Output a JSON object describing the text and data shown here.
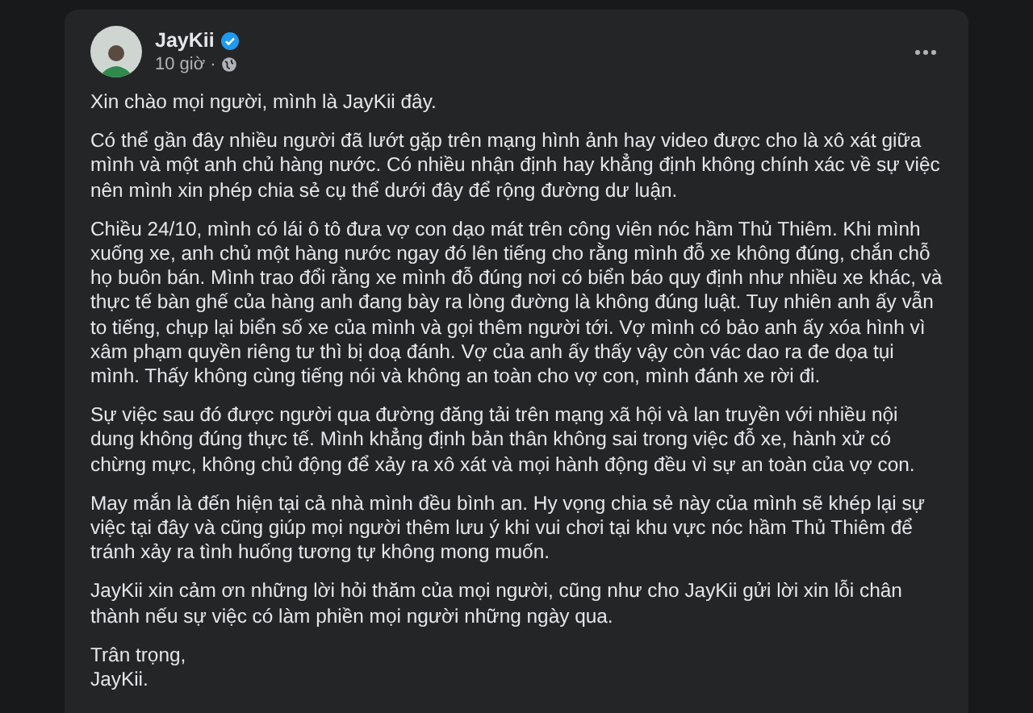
{
  "post": {
    "author": "JayKii",
    "verified": true,
    "time": "10 giờ",
    "separator": "·",
    "paragraphs": [
      "Xin chào mọi người, mình là JayKii đây.",
      "Có thể gần đây nhiều người đã lướt gặp trên mạng hình ảnh hay video được cho là xô xát giữa mình và một anh chủ hàng nước. Có nhiều nhận định hay khẳng định không chính xác về sự việc nên mình xin phép chia sẻ cụ thể dưới đây để rộng đường dư luận.",
      "Chiều 24/10, mình có lái ô tô đưa vợ con dạo mát trên công viên nóc hầm Thủ Thiêm. Khi mình xuống xe, anh chủ một hàng nước ngay đó lên tiếng cho rằng mình đỗ xe không đúng, chắn chỗ họ buôn bán. Mình trao đổi rằng xe mình đỗ đúng nơi có biển báo quy định như nhiều xe khác, và thực tế bàn ghế của hàng anh đang bày ra lòng đường là không đúng luật. Tuy nhiên anh ấy vẫn to tiếng, chụp lại biển số xe của mình và gọi thêm người tới. Vợ mình có bảo anh ấy xóa hình vì xâm phạm quyền riêng tư thì bị doạ đánh. Vợ của anh ấy thấy vậy còn vác dao ra đe dọa tụi mình. Thấy không cùng tiếng nói và không an toàn cho vợ con, mình đánh xe rời đi.",
      "Sự việc sau đó được người qua đường đăng tải trên mạng xã hội và lan truyền với nhiều nội dung không đúng thực tế. Mình khẳng định bản thân không sai trong việc đỗ xe, hành xử có chừng mực, không chủ động để xảy ra xô xát và mọi hành động đều vì sự an toàn của vợ con.",
      "May mắn là đến hiện tại cả nhà mình đều bình an. Hy vọng chia sẻ này của mình sẽ khép lại sự việc tại đây và cũng giúp mọi người thêm lưu ý khi vui chơi tại khu vực nóc hầm Thủ Thiêm để tránh xảy ra tình huống tương tự không mong muốn.",
      "JayKii xin cảm ơn những lời hỏi thăm của mọi người, cũng như cho JayKii gửi lời xin lỗi chân thành nếu sự việc có làm phiền mọi người những ngày qua."
    ],
    "signoff": [
      "Trân trọng,",
      "JayKii."
    ]
  }
}
